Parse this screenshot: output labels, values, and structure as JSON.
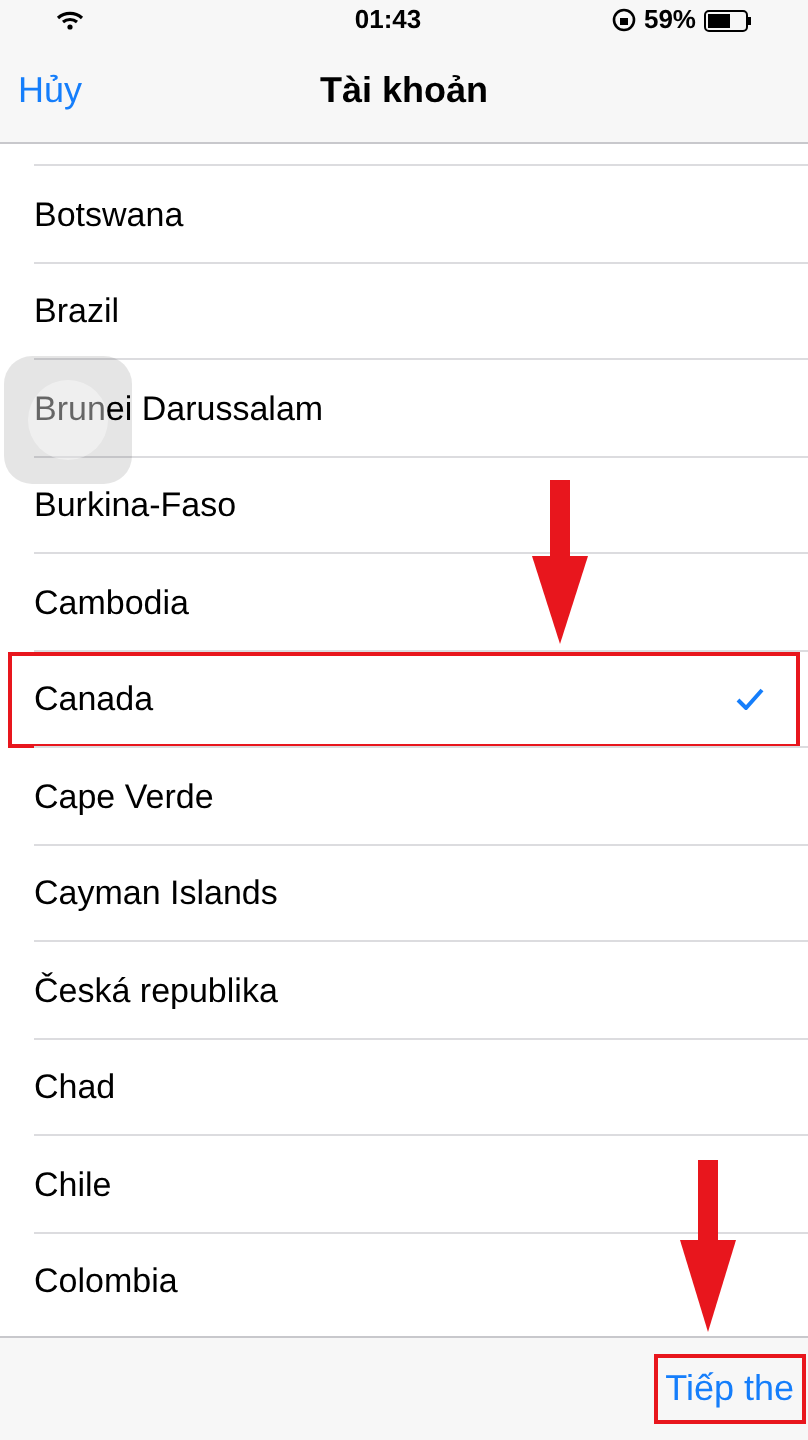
{
  "status_bar": {
    "time": "01:43",
    "battery": "59%"
  },
  "nav": {
    "cancel": "Hủy",
    "title": "Tài khoản"
  },
  "rows": [
    {
      "label": "Botswana",
      "selected": false,
      "highlighted": false
    },
    {
      "label": "Brazil",
      "selected": false,
      "highlighted": false
    },
    {
      "label": "Brunei Darussalam",
      "selected": false,
      "highlighted": false
    },
    {
      "label": "Burkina-Faso",
      "selected": false,
      "highlighted": false
    },
    {
      "label": "Cambodia",
      "selected": false,
      "highlighted": false
    },
    {
      "label": "Canada",
      "selected": true,
      "highlighted": true
    },
    {
      "label": "Cape Verde",
      "selected": false,
      "highlighted": false
    },
    {
      "label": "Cayman Islands",
      "selected": false,
      "highlighted": false
    },
    {
      "label": "Česká republika",
      "selected": false,
      "highlighted": false
    },
    {
      "label": "Chad",
      "selected": false,
      "highlighted": false
    },
    {
      "label": "Chile",
      "selected": false,
      "highlighted": false
    },
    {
      "label": "Colombia",
      "selected": false,
      "highlighted": false
    }
  ],
  "toolbar": {
    "next": "Tiếp the",
    "highlighted": true
  }
}
